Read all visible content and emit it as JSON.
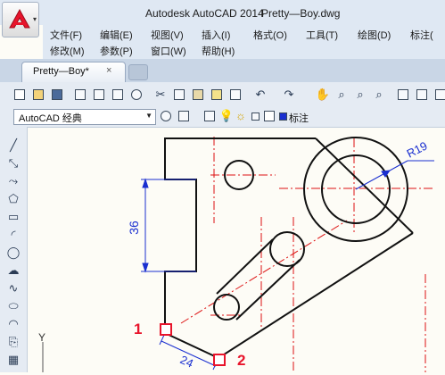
{
  "window": {
    "app_title": "Autodesk AutoCAD 2014",
    "file_title": "Pretty—Boy.dwg"
  },
  "menus_row1": [
    {
      "label": "文件(F)"
    },
    {
      "label": "编辑(E)"
    },
    {
      "label": "视图(V)"
    },
    {
      "label": "插入(I)"
    },
    {
      "label": "格式(O)"
    },
    {
      "label": "工具(T)"
    },
    {
      "label": "绘图(D)"
    },
    {
      "label": "标注("
    }
  ],
  "menus_row2": [
    {
      "label": "修改(M)"
    },
    {
      "label": "参数(P)"
    },
    {
      "label": "窗口(W)"
    },
    {
      "label": "帮助(H)"
    }
  ],
  "doc_tab": {
    "label": "Pretty—Boy*",
    "close": "×"
  },
  "workspace": {
    "value": "AutoCAD 经典"
  },
  "layer": {
    "label": "标注"
  },
  "drawing": {
    "dim_vertical": "36",
    "dim_radius": "R19",
    "dim_angled": "24",
    "marker_1": "1",
    "marker_2": "2",
    "axis_label": "Y"
  },
  "colors": {
    "title_bg": "#dfe8f3",
    "accent_red": "#e8142b",
    "dim_blue": "#1a2fd0",
    "center_red": "#d11"
  },
  "icons": [
    "autocad-logo-icon",
    "new-icon",
    "open-icon",
    "save-icon",
    "plot-icon",
    "preview-icon",
    "publish-icon",
    "cut-icon",
    "copy-icon",
    "paste-icon",
    "match-icon",
    "undo-icon",
    "redo-icon",
    "pan-icon",
    "zoom-icon",
    "properties-icon"
  ]
}
